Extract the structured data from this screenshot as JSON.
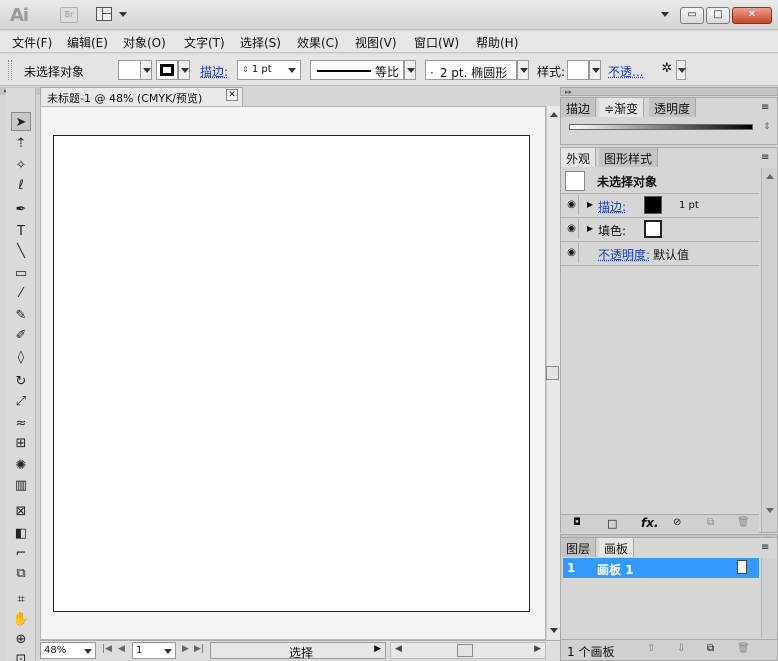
{
  "window": {
    "app_logo": "Ai",
    "bridge_badge": "Br",
    "min_glyph": "▭",
    "max_glyph": "□",
    "close_glyph": "✕"
  },
  "menu": [
    "文件(F)",
    "编辑(E)",
    "对象(O)",
    "文字(T)",
    "选择(S)",
    "效果(C)",
    "视图(V)",
    "窗口(W)",
    "帮助(H)"
  ],
  "control": {
    "selection_status": "未选择对象",
    "stroke_label": "描边:",
    "stroke_weight": "1 pt",
    "profile_label": "等比",
    "brush_label": "2 pt. 椭圆形",
    "brush_dot": "·",
    "style_label": "样式:",
    "opacity_label": "不透..."
  },
  "tools": [
    {
      "name": "selection-tool",
      "glyph": "➤"
    },
    {
      "name": "direct-selection-tool",
      "glyph": "⇡"
    },
    {
      "name": "magic-wand-tool",
      "glyph": "✧"
    },
    {
      "name": "lasso-tool",
      "glyph": "ℓ"
    },
    {
      "name": "pen-tool",
      "glyph": "✒"
    },
    {
      "name": "type-tool",
      "glyph": "T"
    },
    {
      "name": "line-tool",
      "glyph": "╲"
    },
    {
      "name": "rectangle-tool",
      "glyph": "▭"
    },
    {
      "name": "paintbrush-tool",
      "glyph": "⁄"
    },
    {
      "name": "pencil-tool",
      "glyph": "✎"
    },
    {
      "name": "blob-brush-tool",
      "glyph": "✐"
    },
    {
      "name": "eraser-tool",
      "glyph": "◊"
    },
    {
      "name": "rotate-tool",
      "glyph": "↻"
    },
    {
      "name": "scale-tool",
      "glyph": "⤢"
    },
    {
      "name": "warp-tool",
      "glyph": "≈"
    },
    {
      "name": "free-transform-tool",
      "glyph": "⊞"
    },
    {
      "name": "symbol-sprayer-tool",
      "glyph": "✺"
    },
    {
      "name": "column-graph-tool",
      "glyph": "▥"
    },
    {
      "name": "mesh-tool",
      "glyph": "⊠"
    },
    {
      "name": "gradient-tool",
      "glyph": "◧"
    },
    {
      "name": "eyedropper-tool",
      "glyph": "⌐"
    },
    {
      "name": "blend-tool",
      "glyph": "⧉"
    },
    {
      "name": "slice-tool",
      "glyph": "⌗"
    },
    {
      "name": "hand-tool",
      "glyph": "✋"
    },
    {
      "name": "zoom-tool",
      "glyph": "⊕"
    },
    {
      "name": "artboard-tool",
      "glyph": "⊡"
    }
  ],
  "document": {
    "tab_title": "未标题-1 @ 48% (CMYK/预览)",
    "tab_close": "✕",
    "zoom": "48%",
    "page": "1",
    "status_mode": "选择"
  },
  "panels": {
    "stroke_gradient_tabs": [
      "描边",
      "≑渐变",
      "透明度"
    ],
    "appearance_tabs": [
      "外观",
      "图形样式"
    ],
    "appearance": {
      "header": "未选择对象",
      "stroke_label": "描边:",
      "stroke_value": "1 pt",
      "fill_label": "填色:",
      "opacity_label": "不透明度:",
      "opacity_value": "默认值",
      "fx": "fx."
    },
    "layers_tabs": [
      "图层",
      "画板"
    ],
    "artboards": [
      {
        "index": "1",
        "name": "画板 1"
      }
    ],
    "artboards_count": "1 个画板"
  },
  "colors": {
    "selected_row": "#3399ff",
    "link_blue": "#1a3cc8"
  }
}
